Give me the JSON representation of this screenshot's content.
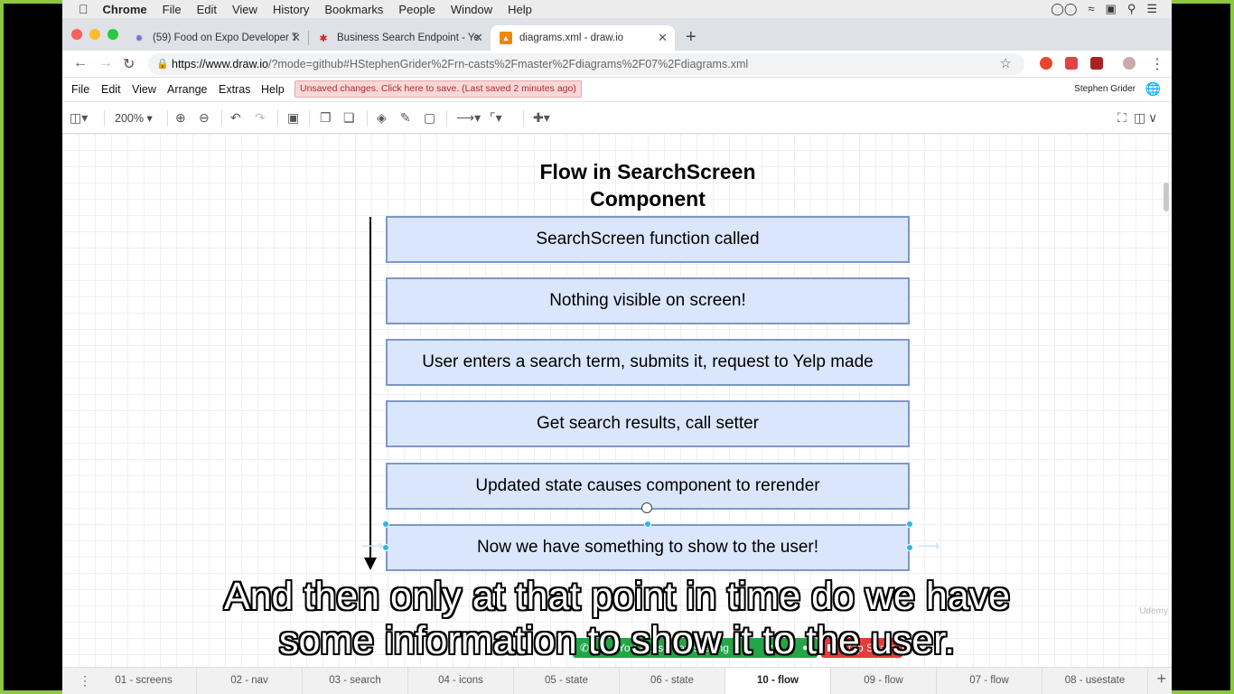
{
  "mac_menubar": {
    "app": "Chrome",
    "items": [
      "File",
      "Edit",
      "View",
      "History",
      "Bookmarks",
      "People",
      "Window",
      "Help"
    ]
  },
  "browser": {
    "tabs": [
      {
        "title": "(59) Food on Expo Developer T",
        "icon": "chat-icon",
        "active": false
      },
      {
        "title": "Business Search Endpoint - Ye",
        "icon": "yelp-icon",
        "active": false
      },
      {
        "title": "diagrams.xml - draw.io",
        "icon": "drawio-icon",
        "active": true
      }
    ],
    "url_host": "https://www.draw.io",
    "url_path": "/?mode=github#HStephenGrider%2Frn-casts%2Fmaster%2Fdiagrams%2F07%2Fdiagrams.xml"
  },
  "drawio": {
    "menu": [
      "File",
      "Edit",
      "View",
      "Arrange",
      "Extras",
      "Help"
    ],
    "unsaved_notice": "Unsaved changes. Click here to save. (Last saved 2 minutes ago)",
    "user": "Stephen Grider",
    "zoom": "200%"
  },
  "diagram": {
    "title_line1": "Flow in SearchScreen",
    "title_line2": "Component",
    "steps": [
      "SearchScreen function called",
      "Nothing visible on screen!",
      "User enters a search term, submits it, request to Yelp made",
      "Get search results, call setter",
      "Updated state causes component to rerender",
      "Now we have something to show to the user!"
    ]
  },
  "page_tabs": [
    {
      "label": "01 - screens",
      "active": false
    },
    {
      "label": "02 - nav",
      "active": false
    },
    {
      "label": "03 - search",
      "active": false
    },
    {
      "label": "04 - icons",
      "active": false
    },
    {
      "label": "05 - state",
      "active": false
    },
    {
      "label": "06 - state",
      "active": false
    },
    {
      "label": "10 - flow",
      "active": true
    },
    {
      "label": "09 - flow",
      "active": false
    },
    {
      "label": "07 - flow",
      "active": false
    },
    {
      "label": "08 - usestate",
      "active": false
    }
  ],
  "screen_share": {
    "status": "You are screen sharing",
    "stop_label": "Stop Share"
  },
  "subtitles": {
    "line1": "And then only at that point in time do we have",
    "line2": "some information to show it to the user."
  },
  "watermark": "Udemy",
  "colors": {
    "frame_border": "#8dc63f",
    "box_fill": "#dae6fb",
    "box_border": "#7d98c6",
    "selection_handle": "#29b6f2",
    "share_green": "#24a548",
    "stop_red": "#e53b3b"
  }
}
